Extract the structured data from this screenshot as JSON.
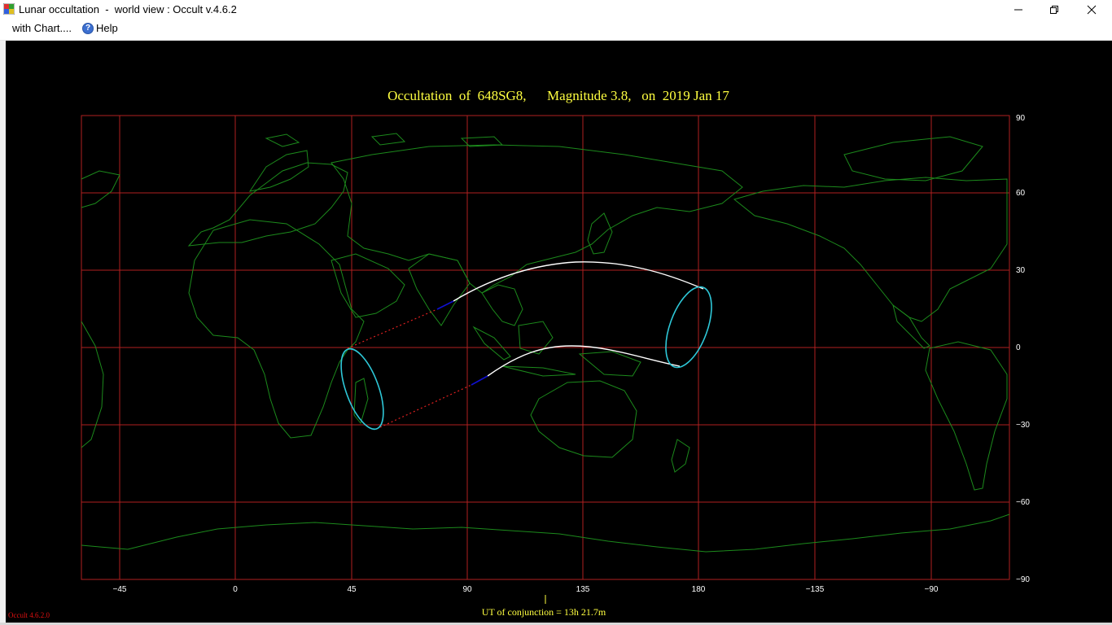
{
  "window": {
    "title": "Lunar occultation  -  world view : Occult v.4.6.2"
  },
  "menu": {
    "items": [
      {
        "label": "with Chart...."
      },
      {
        "label": "Help"
      }
    ]
  },
  "map": {
    "title": "Occultation  of  648SG8,      Magnitude 3.8,   on  2019 Jan 17",
    "conjunction": "UT of conjunction = 13h 21.7m",
    "version": "Occult 4.6.2.0",
    "lon_labels": [
      "-45",
      "0",
      "45",
      "90",
      "135",
      "180",
      "-135",
      "-90"
    ],
    "lat_labels": [
      "90",
      "60",
      "30",
      "0",
      "-30",
      "-60",
      "-90"
    ],
    "colors": {
      "background": "#000000",
      "grid": "#b02020",
      "coast": "#1c8a1c",
      "title": "#ffff40",
      "path": "#ffffff",
      "ellipse": "#2ec8d8",
      "twilight": "#1010d0",
      "below_horizon": "#e02020"
    }
  }
}
